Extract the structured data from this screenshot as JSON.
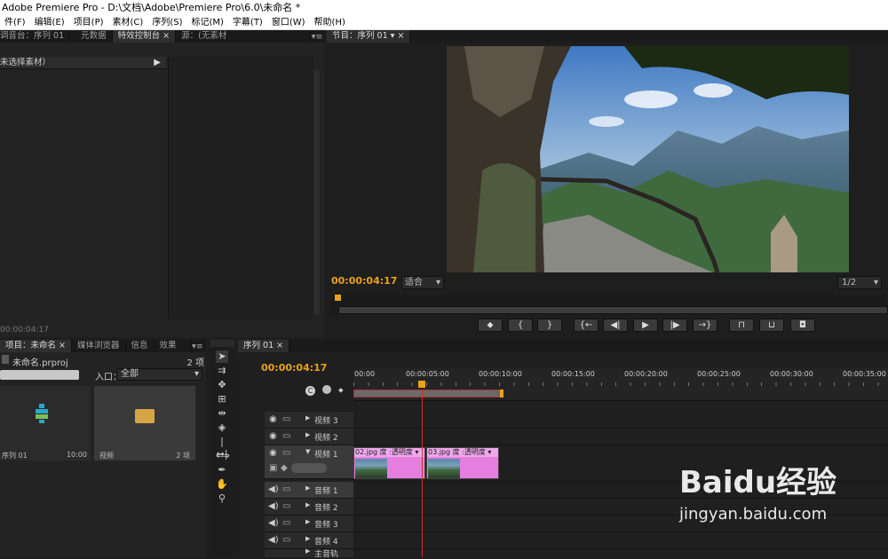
{
  "window_title": "Adobe Premiere Pro - D:\\文档\\Adobe\\Premiere Pro\\6.0\\未命名 *",
  "menu": [
    "件(F)",
    "编辑(E)",
    "项目(P)",
    "素材(C)",
    "序列(S)",
    "标记(M)",
    "字幕(T)",
    "窗口(W)",
    "帮助(H)"
  ],
  "source_panel": {
    "tabs": [
      "调音台：序列 01",
      "元数据",
      "特效控制台",
      "源：(无素材"
    ],
    "no_clip": "未选择素材）",
    "timecode": "00:00:04:17"
  },
  "program_monitor": {
    "tab": "节目：序列 01",
    "timecode": "00:00:04:17",
    "fit": "适合",
    "resolution": "1/2",
    "buttons": [
      "marker",
      "in",
      "out",
      "go-in",
      "step-back",
      "play",
      "step-forward",
      "go-out",
      "lift",
      "extract",
      "export-frame"
    ]
  },
  "project_panel": {
    "tabs": [
      "项目：未命名",
      "媒体浏览器",
      "信息",
      "效果"
    ],
    "file": "未命名.prproj",
    "count": "2 项",
    "in_label": "入口：",
    "in_value": "全部",
    "items": [
      {
        "name": "序列 01",
        "meta": "10:00"
      },
      {
        "name": "视频",
        "meta": "2 项"
      }
    ]
  },
  "timeline": {
    "tab": "序列 01",
    "timecode": "00:00:04:17",
    "ruler": [
      "00:00",
      "00:00:05:00",
      "00:00:10:00",
      "00:00:15:00",
      "00:00:20:00",
      "00:00:25:00",
      "00:00:30:00",
      "00:00:35:00"
    ],
    "video_tracks": [
      "视频 3",
      "视频 2",
      "视频 1"
    ],
    "audio_tracks": [
      "音频 1",
      "音频 2",
      "音频 3",
      "音频 4"
    ],
    "master": "主音轨",
    "clips": [
      {
        "name": "02.jpg",
        "fx": "度 :透明度 ▾"
      },
      {
        "name": "03.jpg",
        "fx": "度 :透明度 ▾"
      }
    ]
  },
  "watermark": {
    "brand": "Baidu经验",
    "url": "jingyan.baidu.com"
  },
  "colors": {
    "timecode": "#e8a21b",
    "clip": "#e67ee0",
    "playhead": "#d03030"
  }
}
